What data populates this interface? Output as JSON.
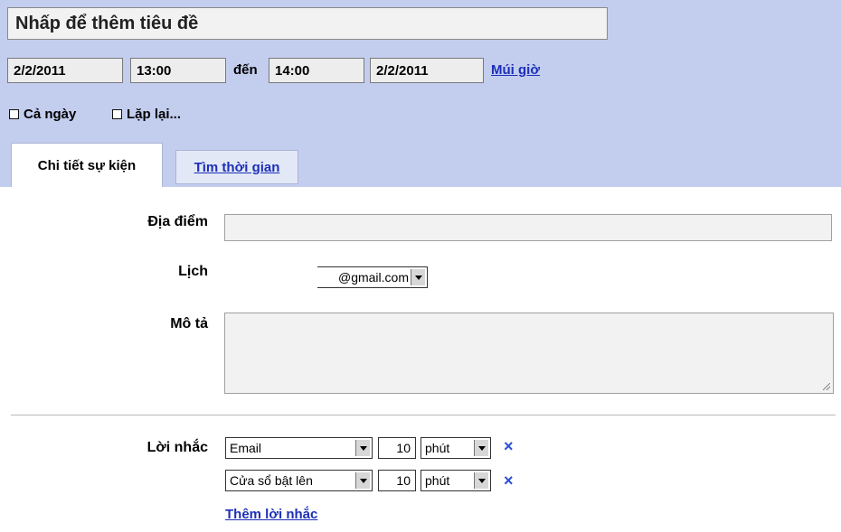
{
  "event": {
    "title_placeholder": "Nhấp để thêm tiêu đề",
    "start_date": "2/2/2011",
    "start_time": "13:00",
    "to_label": "đến",
    "end_time": "14:00",
    "end_date": "2/2/2011",
    "timezone_link": "Múi giờ",
    "all_day_label": "Cả ngày",
    "repeat_label": "Lặp lại..."
  },
  "tabs": [
    {
      "label": "Chi tiết sự kiện",
      "active": true
    },
    {
      "label": "Tìm thời gian",
      "active": false
    }
  ],
  "details": {
    "location_label": "Địa điểm",
    "location_value": "",
    "calendar_label": "Lịch",
    "calendar_value": "@gmail.com",
    "description_label": "Mô tả",
    "description_value": ""
  },
  "reminders": {
    "label": "Lời nhắc",
    "items": [
      {
        "method": "Email",
        "amount": "10",
        "unit": "phút",
        "remove_icon": "×"
      },
      {
        "method": "Cửa sổ bật lên",
        "amount": "10",
        "unit": "phút",
        "remove_icon": "×"
      }
    ],
    "add_link": "Thêm lời nhắc"
  },
  "colors": {
    "header_bg": "#c3cdee",
    "link": "#1c2fb8",
    "remove_icon": "#2a4fd6"
  }
}
